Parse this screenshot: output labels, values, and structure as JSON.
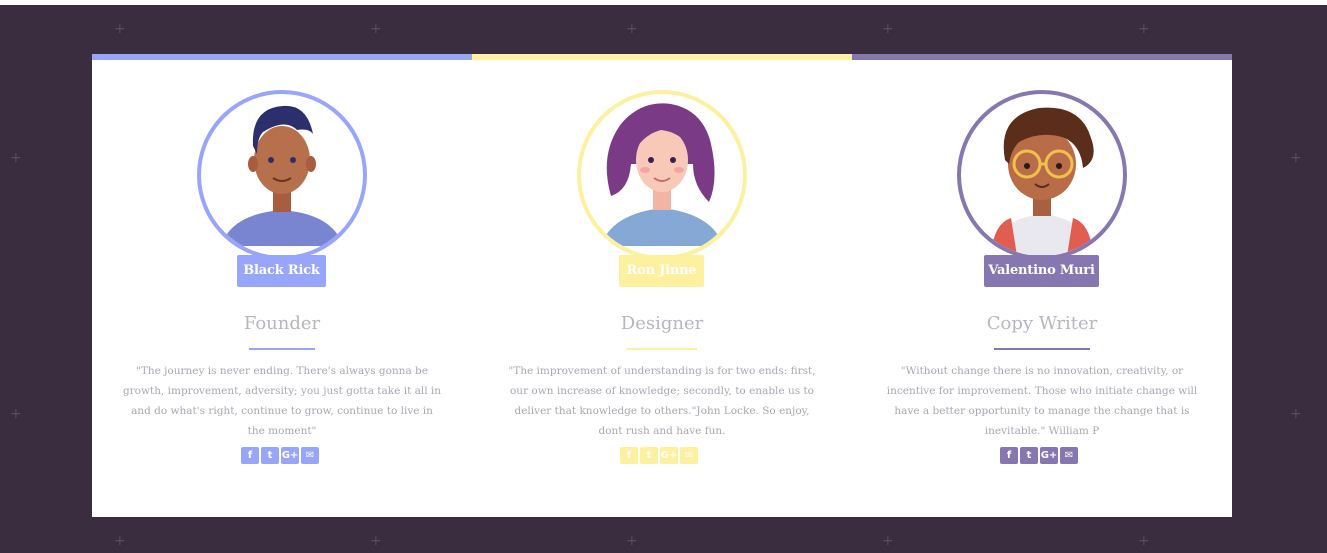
{
  "colors": {
    "page_background": "#3a2d40",
    "card_background": "#ffffff",
    "blue": "#97a6fb",
    "yellow": "#fdf09e",
    "purple": "#8777b0"
  },
  "team": [
    {
      "name": "Black Rick",
      "role": "Founder",
      "quote": "\"The journey is never ending. There's always gonna be growth, improvement, adversity; you just gotta take it all in and do what's right, continue to grow, continue to live in the moment\"",
      "accent": "#97a6fb",
      "socials": [
        "facebook-icon",
        "twitter-icon",
        "google-plus-icon",
        "email-icon"
      ]
    },
    {
      "name": "Ron Jinne",
      "role": "Designer",
      "quote": "\"The improvement of understanding is for two ends: first, our own increase of knowledge; secondly, to enable us to deliver that knowledge to others.\"John Locke. So enjoy, dont rush and have fun.",
      "accent": "#fdf09e",
      "socials": [
        "facebook-icon",
        "twitter-icon",
        "google-plus-icon",
        "email-icon"
      ]
    },
    {
      "name": "Valentino Muri",
      "role": "Copy Writer",
      "quote": "\"Without change there is no innovation, creativity, or incentive for improvement. Those who initiate change will have a better opportunity to manage the change that is inevitable.\" William P",
      "accent": "#8777b0",
      "socials": [
        "facebook-icon",
        "twitter-icon",
        "google-plus-icon",
        "email-icon"
      ]
    }
  ]
}
